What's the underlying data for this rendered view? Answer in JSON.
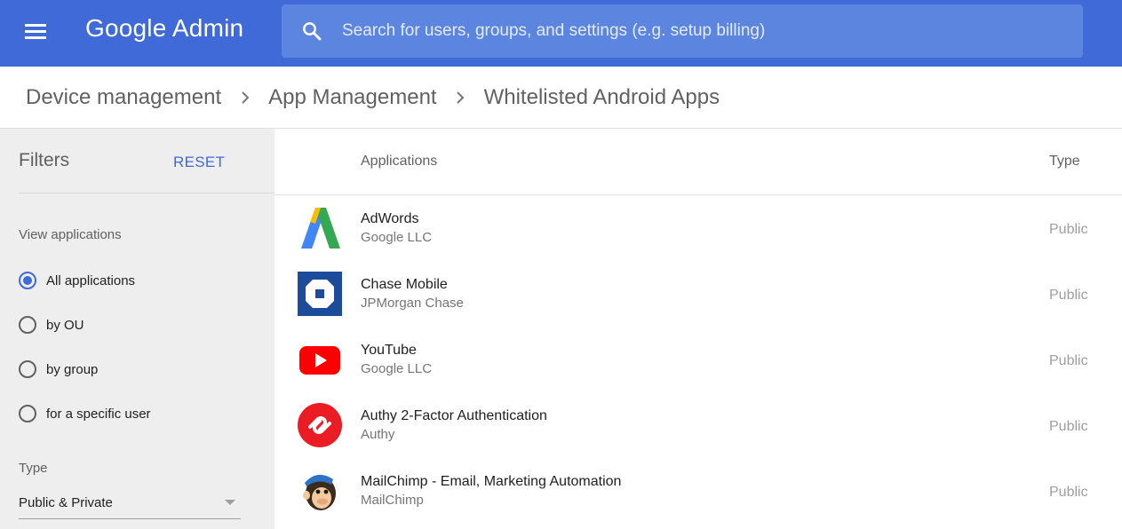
{
  "header": {
    "logo": "Google Admin",
    "search_placeholder": "Search for users, groups, and settings (e.g. setup billing)",
    "bar_color": "#3f6ad8"
  },
  "breadcrumb": [
    {
      "label": "Device management"
    },
    {
      "label": "App Management"
    },
    {
      "label": "Whitelisted Android Apps"
    }
  ],
  "sidebar": {
    "title": "Filters",
    "reset_label": "RESET",
    "view_label": "View applications",
    "view_options": [
      {
        "label": "All applications",
        "checked": true
      },
      {
        "label": "by OU",
        "checked": false
      },
      {
        "label": "by group",
        "checked": false
      },
      {
        "label": "for a specific user",
        "checked": false
      }
    ],
    "type_label": "Type",
    "type_value": "Public & Private"
  },
  "table": {
    "columns": {
      "applications": "Applications",
      "type": "Type"
    },
    "rows": [
      {
        "name": "AdWords",
        "developer": "Google LLC",
        "type": "Public",
        "icon": "adwords-icon"
      },
      {
        "name": "Chase Mobile",
        "developer": "JPMorgan Chase",
        "type": "Public",
        "icon": "chase-icon"
      },
      {
        "name": "YouTube",
        "developer": "Google LLC",
        "type": "Public",
        "icon": "youtube-icon"
      },
      {
        "name": "Authy 2-Factor Authentication",
        "developer": "Authy",
        "type": "Public",
        "icon": "authy-icon"
      },
      {
        "name": "MailChimp - Email, Marketing Automation",
        "developer": "MailChimp",
        "type": "Public",
        "icon": "mailchimp-icon"
      }
    ]
  }
}
